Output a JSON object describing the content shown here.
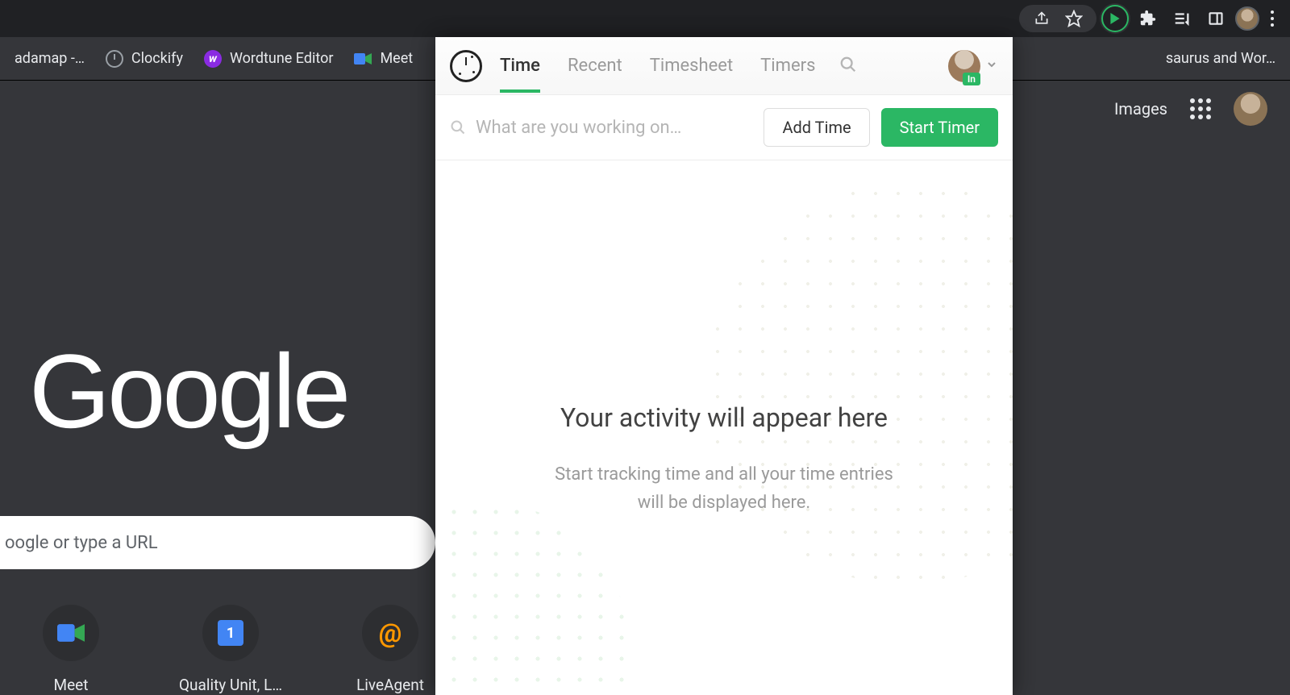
{
  "chrome": {
    "bookmarks": [
      {
        "label": "adamap -…",
        "icon": "generic"
      },
      {
        "label": "Clockify",
        "icon": "clockify"
      },
      {
        "label": "Wordtune Editor",
        "icon": "wordtune"
      },
      {
        "label": "Meet",
        "icon": "meet"
      },
      {
        "label": "",
        "icon": "drive"
      }
    ],
    "bookmark_right": "saurus and Wor…"
  },
  "ntp": {
    "images_link": "Images",
    "logo": "Google",
    "search_placeholder": "oogle or type a URL",
    "shortcuts": [
      {
        "label": "Meet"
      },
      {
        "label": "Quality Unit, L…"
      },
      {
        "label": "LiveAgent"
      }
    ]
  },
  "popup": {
    "tabs": [
      {
        "label": "Time",
        "active": true
      },
      {
        "label": "Recent",
        "active": false
      },
      {
        "label": "Timesheet",
        "active": false
      },
      {
        "label": "Timers",
        "active": false
      }
    ],
    "status_badge": "In",
    "work_placeholder": "What are you working on…",
    "add_time_label": "Add Time",
    "start_timer_label": "Start Timer",
    "empty_title": "Your activity will appear here",
    "empty_sub": "Start tracking time and all your time entries will be displayed here."
  }
}
